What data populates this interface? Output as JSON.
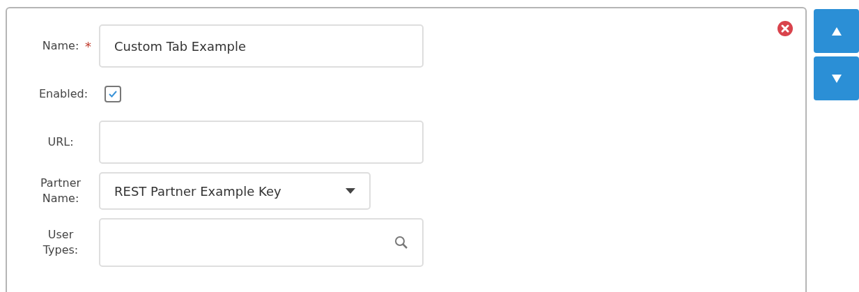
{
  "fields": [
    {
      "kind": "text",
      "label": "Name:",
      "required": true,
      "value": "Custom Tab Example"
    },
    {
      "kind": "checkbox",
      "label": "Enabled:",
      "required": false,
      "checked": true
    },
    {
      "kind": "text",
      "label": "URL:",
      "required": false
    },
    {
      "kind": "select",
      "label": "Partner Name:",
      "required": false,
      "value": "REST Partner Example Key"
    },
    {
      "kind": "search",
      "label": "User Types:",
      "required": false
    }
  ],
  "required_mark": "*"
}
